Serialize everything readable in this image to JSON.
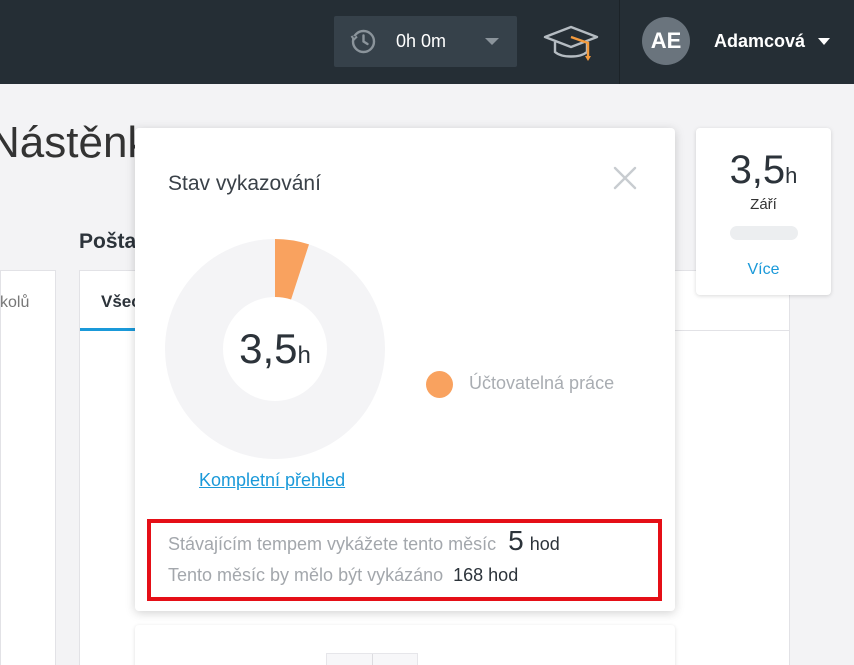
{
  "topbar": {
    "timer_value": "0h 0m",
    "user_initials": "AE",
    "user_name": "Adamcová"
  },
  "page": {
    "title": "Nástěnka",
    "section_title": "Pošta",
    "left_card_label": "kolů",
    "tab_label": "Všec"
  },
  "summary_card": {
    "value": "3,5",
    "unit": "h",
    "month": "Září",
    "more_link": "Více"
  },
  "popup": {
    "title": "Stav vykazování",
    "donut_value": "3,5",
    "donut_unit": "h",
    "legend_label": "Účtovatelná práce",
    "full_overview_link": "Kompletní přehled",
    "pace_label": "Stávajícím tempem vykážete tento měsíc",
    "pace_value": "5",
    "pace_unit": "hod",
    "expected_label": "Tento měsíc by mělo být vykázáno",
    "expected_value": "168",
    "expected_unit": "hod",
    "billable_fraction": 0.05
  },
  "colors": {
    "topbar": "#252e35",
    "accent_blue": "#1a99d9",
    "billable_orange": "#f9a25f",
    "highlight_red": "#e50f17"
  },
  "icons": [
    "clock-icon",
    "graduation-cap-icon",
    "close-icon",
    "chevron-down-icon"
  ]
}
